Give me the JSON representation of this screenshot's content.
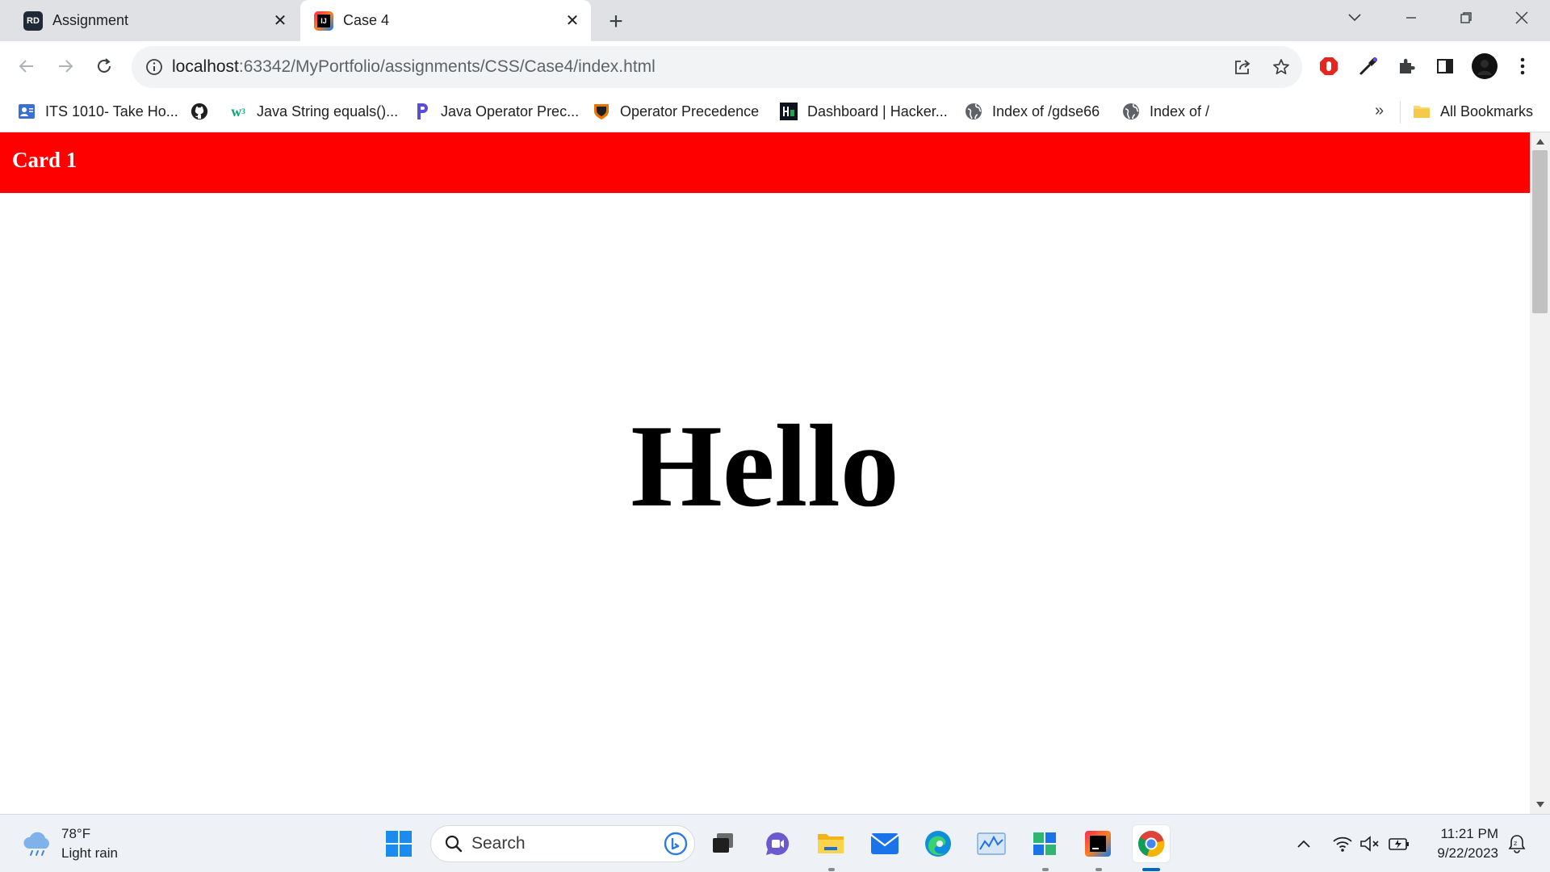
{
  "browser": {
    "tabs": [
      {
        "title": "Assignment",
        "favicon": "rd-icon",
        "active": false
      },
      {
        "title": "Case 4",
        "favicon": "intellij-icon",
        "active": true
      }
    ],
    "url_host": "localhost",
    "url_path": ":63342/MyPortfolio/assignments/CSS/Case4/index.html",
    "bookmarks": [
      {
        "label": "ITS 1010- Take Ho...",
        "icon": "user-icon"
      },
      {
        "label": "",
        "icon": "github-icon"
      },
      {
        "label": "Java String equals()...",
        "icon": "w3schools-icon"
      },
      {
        "label": "Java Operator Prec...",
        "icon": "programiz-icon"
      },
      {
        "label": "Operator Precedence",
        "icon": "princeton-icon"
      },
      {
        "label": "Dashboard | Hacker...",
        "icon": "hackerrank-icon"
      },
      {
        "label": "Index of /gdse66",
        "icon": "globe-icon"
      },
      {
        "label": "Index of /",
        "icon": "globe-icon"
      }
    ],
    "bookmarks_overflow": "»",
    "all_bookmarks": "All Bookmarks"
  },
  "page": {
    "card_title": "Card 1",
    "heading": "Hello",
    "header_color": "#ff0000"
  },
  "taskbar": {
    "weather_temp": "78°F",
    "weather_desc": "Light rain",
    "search_label": "Search",
    "time": "11:21 PM",
    "date": "9/22/2023"
  }
}
